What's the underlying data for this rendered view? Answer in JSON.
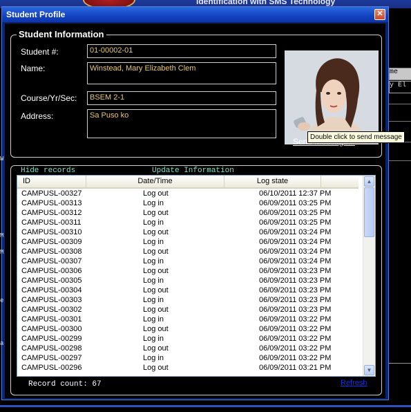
{
  "background_app": {
    "title": "Identification with SMS Technology",
    "right_fragments": [
      "me",
      "y El"
    ],
    "left_fragments": [
      "W",
      "M",
      "M",
      "e",
      "a"
    ]
  },
  "dialog": {
    "title": "Student Profile",
    "close_glyph": "✕"
  },
  "student_info": {
    "legend": "Student Information",
    "student_no_label": "Student #:",
    "student_no": "01-00002-01",
    "name_label": "Name:",
    "name": "Winstead, Mary Elizabeth Clem",
    "course_label": "Course/Yr/Sec:",
    "course": "BSEM 2-1",
    "address_label": "Address:",
    "address": "Sa Puso ko",
    "hide_records": "Hide records",
    "update_info": "Update Information",
    "send_message": "Send Message...",
    "tooltip": "Double click to send message"
  },
  "records": {
    "columns": [
      "ID",
      "Date/Time",
      "Log state"
    ],
    "rows": [
      [
        "CAMPUSL-00327",
        "Log out",
        "06/10/2011 12:37 PM"
      ],
      [
        "CAMPUSL-00313",
        "Log in",
        "06/09/2011 03:25 PM"
      ],
      [
        "CAMPUSL-00312",
        "Log out",
        "06/09/2011 03:25 PM"
      ],
      [
        "CAMPUSL-00311",
        "Log in",
        "06/09/2011 03:25 PM"
      ],
      [
        "CAMPUSL-00310",
        "Log out",
        "06/09/2011 03:24 PM"
      ],
      [
        "CAMPUSL-00309",
        "Log in",
        "06/09/2011 03:24 PM"
      ],
      [
        "CAMPUSL-00308",
        "Log out",
        "06/09/2011 03:24 PM"
      ],
      [
        "CAMPUSL-00307",
        "Log in",
        "06/09/2011 03:24 PM"
      ],
      [
        "CAMPUSL-00306",
        "Log out",
        "06/09/2011 03:23 PM"
      ],
      [
        "CAMPUSL-00305",
        "Log in",
        "06/09/2011 03:23 PM"
      ],
      [
        "CAMPUSL-00304",
        "Log out",
        "06/09/2011 03:23 PM"
      ],
      [
        "CAMPUSL-00303",
        "Log in",
        "06/09/2011 03:23 PM"
      ],
      [
        "CAMPUSL-00302",
        "Log out",
        "06/09/2011 03:23 PM"
      ],
      [
        "CAMPUSL-00301",
        "Log in",
        "06/09/2011 03:22 PM"
      ],
      [
        "CAMPUSL-00300",
        "Log out",
        "06/09/2011 03:22 PM"
      ],
      [
        "CAMPUSL-00299",
        "Log in",
        "06/09/2011 03:22 PM"
      ],
      [
        "CAMPUSL-00298",
        "Log out",
        "06/09/2011 03:22 PM"
      ],
      [
        "CAMPUSL-00297",
        "Log in",
        "06/09/2011 03:22 PM"
      ],
      [
        "CAMPUSL-00296",
        "Log out",
        "06/09/2011 03:21 PM"
      ]
    ],
    "record_count": "Record count: 67",
    "refresh": "Refresh"
  },
  "colors": {
    "titlebar": "#1342c0",
    "field_text": "#e8c86a",
    "link_mono": "#7fe0c8"
  }
}
